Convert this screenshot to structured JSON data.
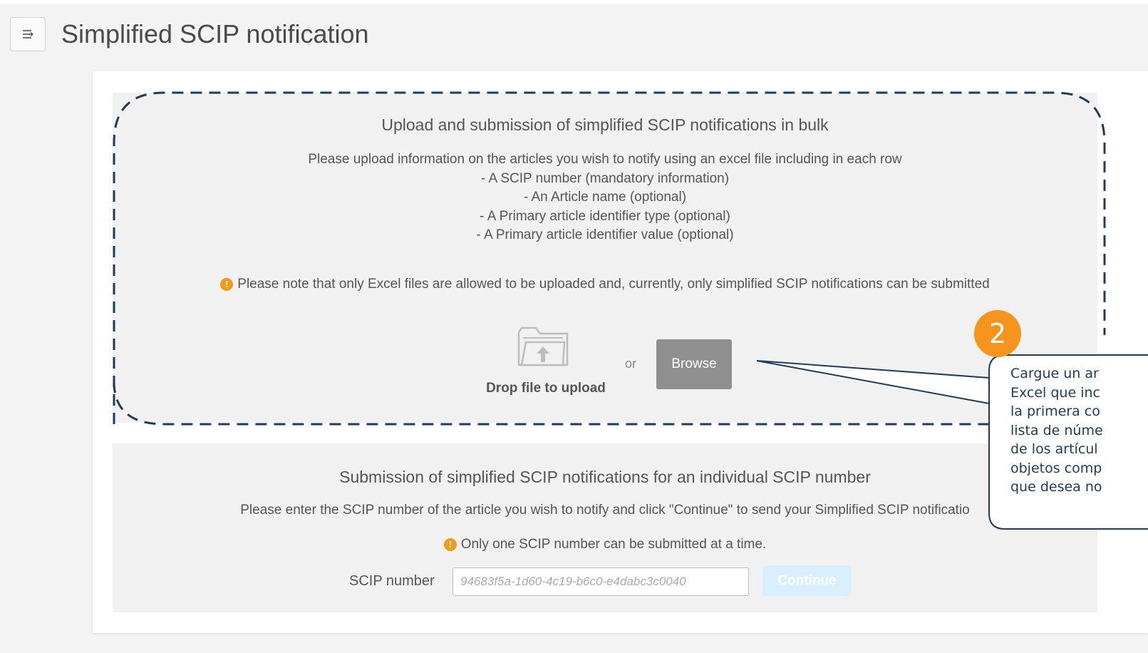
{
  "header": {
    "menu_icon": "menu-collapse-icon",
    "title": "Simplified SCIP notification"
  },
  "bulk": {
    "title": "Upload and submission of simplified SCIP notifications in bulk",
    "intro": "Please upload information on the articles you wish to notify using an excel file including in each row",
    "items": [
      "- A SCIP number (mandatory information)",
      "- An Article name (optional)",
      "- A Primary article identifier type (optional)",
      "- A Primary article identifier value (optional)"
    ],
    "note_icon": "!",
    "note": "Please note that only Excel files are allowed to be uploaded and, currently, only simplified SCIP notifications can be submitted",
    "drop_label": "Drop file to upload",
    "or_label": "or",
    "browse_label": "Browse"
  },
  "single": {
    "title": "Submission of simplified SCIP notifications for an individual SCIP number",
    "intro": "Please enter the SCIP number of the article you wish to notify and click \"Continue\" to send your Simplified SCIP notificatio",
    "note_icon": "!",
    "note": "Only one SCIP number can be submitted at a time.",
    "field_label": "SCIP number",
    "field_placeholder": "94683f5a-1d60-4c19-b6c0-e4dabc3c0040",
    "continue_label": "Continue"
  },
  "callout": {
    "number": "2",
    "lines": [
      "Cargue un ar",
      "Excel que inc",
      "la primera co",
      "lista de núme",
      "de los artícul",
      "objetos comp",
      "que desea no"
    ]
  },
  "colors": {
    "warning": "#f29a1c",
    "callout_badge": "#f7941d",
    "callout_border": "#1f3b5a",
    "dashed_outline": "#1f3b5a"
  }
}
